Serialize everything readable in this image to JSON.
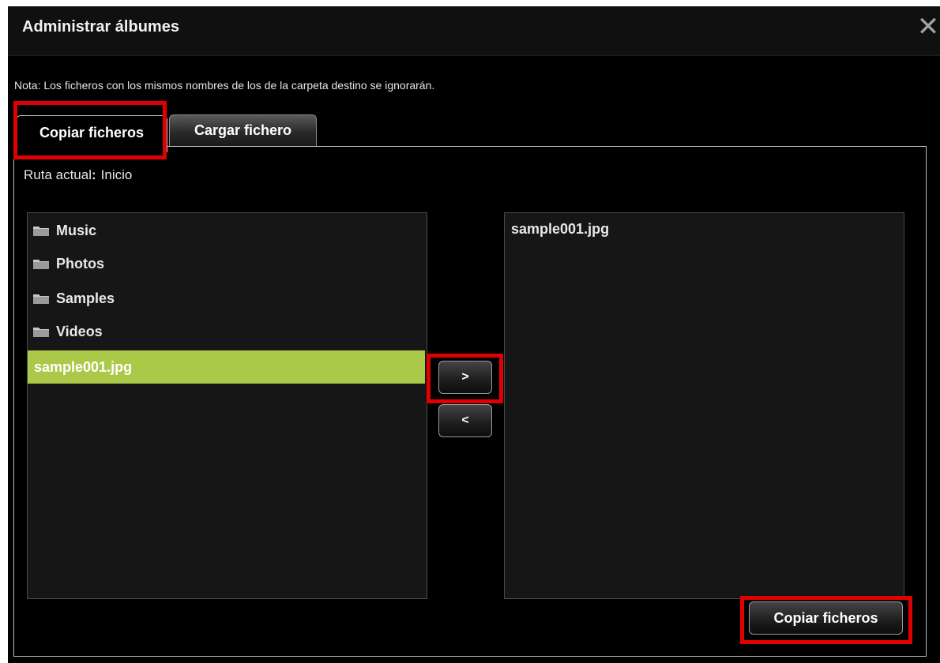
{
  "dialog": {
    "title": "Administrar álbumes",
    "close_glyph": "✕",
    "note": "Nota: Los ficheros con los mismos nombres de los de la carpeta destino se ignorarán."
  },
  "tabs": [
    {
      "label": "Copiar ficheros",
      "active": true
    },
    {
      "label": "Cargar fichero",
      "active": false
    }
  ],
  "path": {
    "label": "Ruta actual",
    "separator": ":",
    "value": "Inicio"
  },
  "source_list": {
    "items": [
      {
        "label": "Music",
        "type": "folder",
        "icon": "folder-icon"
      },
      {
        "label": "Photos",
        "type": "folder",
        "icon": "folder-icon"
      },
      {
        "label": "Samples",
        "type": "folder",
        "icon": "folder-icon"
      },
      {
        "label": "Videos",
        "type": "folder",
        "icon": "folder-icon"
      },
      {
        "label": "sample001.jpg",
        "type": "file",
        "selected": true
      }
    ]
  },
  "target_list": {
    "items": [
      {
        "label": "sample001.jpg",
        "type": "file"
      }
    ]
  },
  "transfer_buttons": {
    "add_label": ">",
    "remove_label": "<"
  },
  "actions": {
    "copy_label": "Copiar ficheros"
  },
  "colors": {
    "selected_row": "#abc948",
    "highlight_box": "#e10000",
    "background": "#000000"
  }
}
